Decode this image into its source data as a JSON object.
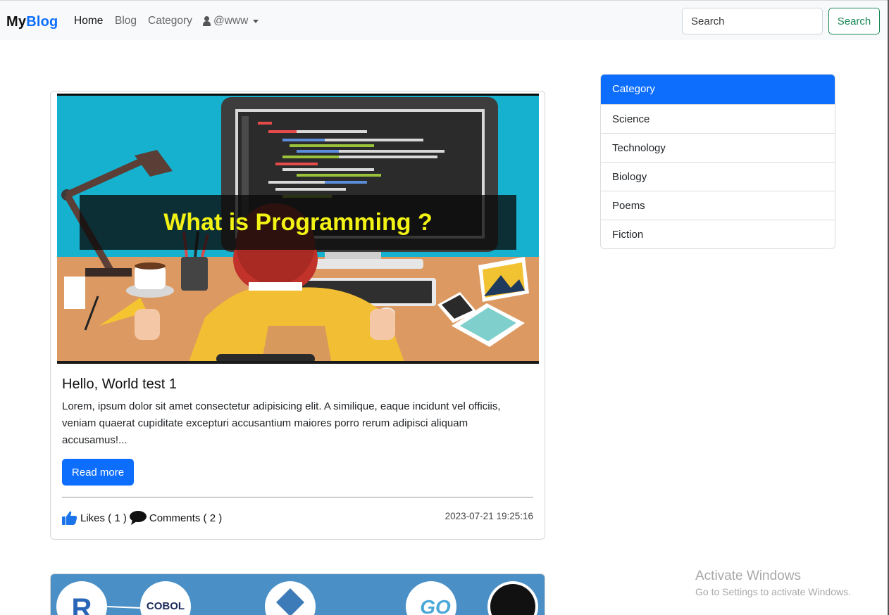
{
  "navbar": {
    "brand_prefix": "My",
    "brand_suffix": "Blog",
    "links": [
      {
        "label": "Home"
      },
      {
        "label": "Blog"
      },
      {
        "label": "Category"
      }
    ],
    "user_label": "@www",
    "search_placeholder": "Search",
    "search_button": "Search"
  },
  "post": {
    "image_banner": "What is Programming ?",
    "title": "Hello, World test 1",
    "excerpt": "Lorem, ipsum dolor sit amet consectetur adipisicing elit. A similique, eaque incidunt vel officiis, veniam quaerat cupiditate excepturi accusantium maiores porro rerum adipisci aliquam accusamus!...",
    "read_more": "Read more",
    "likes_label": "Likes ( 1 )",
    "comments_label": "Comments ( 2 )",
    "timestamp": "2023-07-21 19:25:16"
  },
  "post2": {
    "logos": [
      "R",
      "COBOL",
      "GO"
    ]
  },
  "categories": {
    "header": "Category",
    "items": [
      {
        "label": "Science"
      },
      {
        "label": "Technology"
      },
      {
        "label": "Biology"
      },
      {
        "label": "Poems"
      },
      {
        "label": "Fiction"
      }
    ]
  },
  "watermark": {
    "title": "Activate Windows",
    "subtitle": "Go to Settings to activate Windows."
  },
  "colors": {
    "primary": "#0d6efd",
    "success": "#198754",
    "navbar_bg": "#f8f9fa"
  }
}
